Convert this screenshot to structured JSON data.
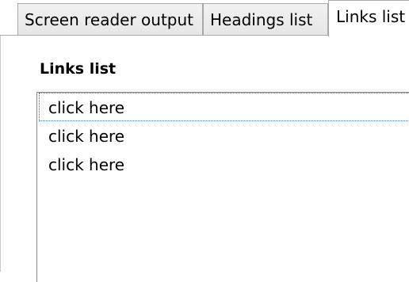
{
  "tabs": [
    {
      "label": "Screen reader output",
      "selected": false
    },
    {
      "label": "Headings list",
      "selected": false
    },
    {
      "label": "Links list",
      "selected": true
    }
  ],
  "panel": {
    "section_label": "Links list",
    "links": [
      {
        "text": "click here",
        "focused": true
      },
      {
        "text": "click here",
        "focused": false
      },
      {
        "text": "click here",
        "focused": false
      }
    ]
  },
  "colors": {
    "tab_border": "#a9a9a9",
    "focus_outline": "#3b7ed6"
  }
}
